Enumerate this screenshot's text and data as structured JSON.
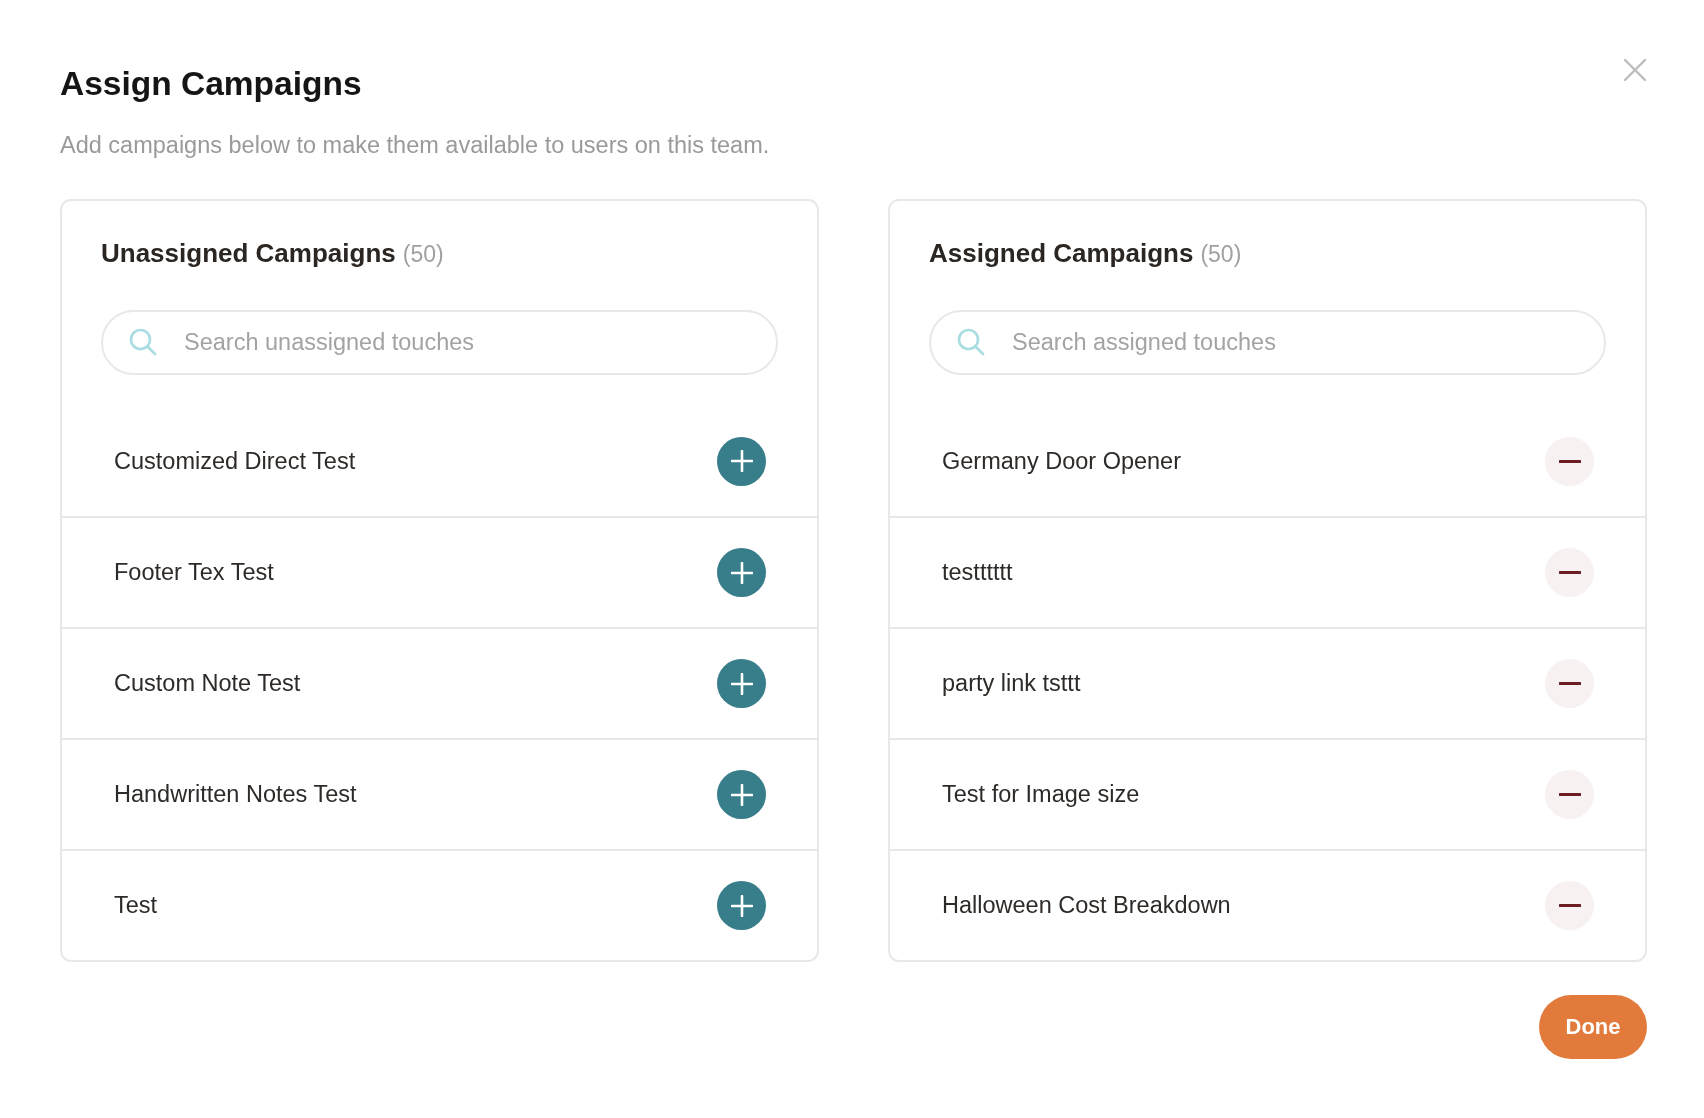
{
  "dialog": {
    "title": "Assign Campaigns",
    "subtitle": "Add campaigns below to make them available to users on this team."
  },
  "panels": [
    {
      "kind": "add",
      "title": "Unassigned Campaigns",
      "count": "(50)",
      "search": {
        "placeholder": "Search unassigned touches"
      },
      "items": [
        "Customized Direct Test",
        "Footer Tex Test",
        "Custom Note Test",
        "Handwritten Notes Test",
        "Test"
      ]
    },
    {
      "kind": "remove",
      "title": "Assigned Campaigns",
      "count": "(50)",
      "search": {
        "placeholder": "Search assigned touches"
      },
      "items": [
        "Germany Door Opener",
        "testttttt",
        "party link tsttt",
        "Test for Image size",
        "Halloween Cost Breakdown"
      ]
    }
  ],
  "footer": {
    "done_button": "Done"
  }
}
